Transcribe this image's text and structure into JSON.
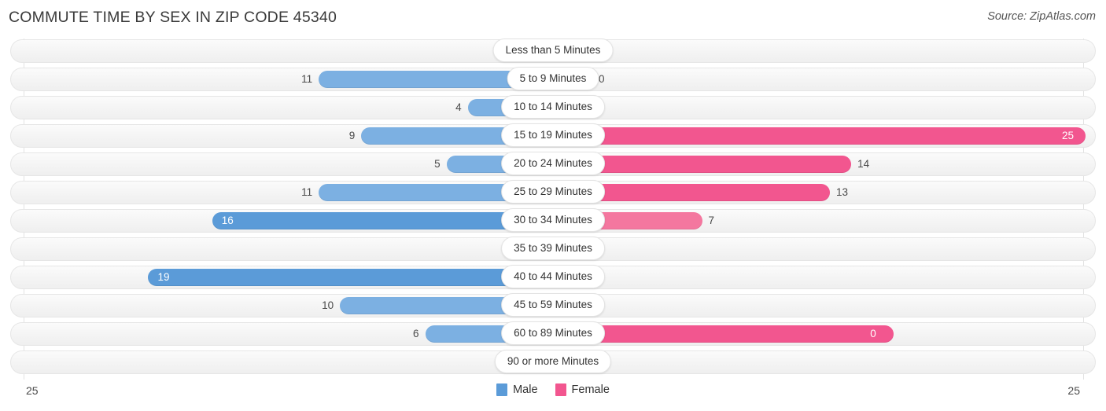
{
  "header": {
    "title": "COMMUTE TIME BY SEX IN ZIP CODE 45340",
    "source": "Source: ZipAtlas.com"
  },
  "legend": {
    "male_label": "Male",
    "female_label": "Female",
    "male_color": "#5b9bd8",
    "female_color": "#f2568f"
  },
  "axis": {
    "left_tick": "25",
    "right_tick": "25",
    "max": 25
  },
  "chart_data": {
    "type": "bar",
    "orientation": "horizontal-diverging",
    "title": "COMMUTE TIME BY SEX IN ZIP CODE 45340",
    "xlabel": "",
    "ylabel": "",
    "xlim": [
      -25,
      25
    ],
    "grid": true,
    "legend_position": "bottom-center",
    "categories": [
      "Less than 5 Minutes",
      "5 to 9 Minutes",
      "10 to 14 Minutes",
      "15 to 19 Minutes",
      "20 to 24 Minutes",
      "25 to 29 Minutes",
      "30 to 34 Minutes",
      "35 to 39 Minutes",
      "40 to 44 Minutes",
      "45 to 59 Minutes",
      "60 to 89 Minutes",
      "90 or more Minutes"
    ],
    "series": [
      {
        "name": "Male",
        "side": "left",
        "values": [
          0,
          11,
          4,
          9,
          5,
          11,
          16,
          0,
          19,
          10,
          6,
          0
        ]
      },
      {
        "name": "Female",
        "side": "right",
        "values": [
          0,
          0,
          0,
          25,
          14,
          13,
          7,
          0,
          0,
          0,
          16,
          0
        ]
      }
    ]
  },
  "rows": [
    {
      "label": "Less than 5 Minutes",
      "male": "0",
      "female": "0"
    },
    {
      "label": "5 to 9 Minutes",
      "male": "11",
      "female": "0"
    },
    {
      "label": "10 to 14 Minutes",
      "male": "4",
      "female": "0"
    },
    {
      "label": "15 to 19 Minutes",
      "male": "9",
      "female": "25"
    },
    {
      "label": "20 to 24 Minutes",
      "male": "5",
      "female": "14"
    },
    {
      "label": "25 to 29 Minutes",
      "male": "11",
      "female": "13"
    },
    {
      "label": "30 to 34 Minutes",
      "male": "16",
      "female": "7"
    },
    {
      "label": "35 to 39 Minutes",
      "male": "0",
      "female": "0"
    },
    {
      "label": "40 to 44 Minutes",
      "male": "19",
      "female": "0"
    },
    {
      "label": "45 to 59 Minutes",
      "male": "10",
      "female": "0"
    },
    {
      "label": "60 to 89 Minutes",
      "male": "6",
      "female": "0"
    },
    {
      "label": "90 or more Minutes",
      "male": "0",
      "female": "0"
    }
  ]
}
